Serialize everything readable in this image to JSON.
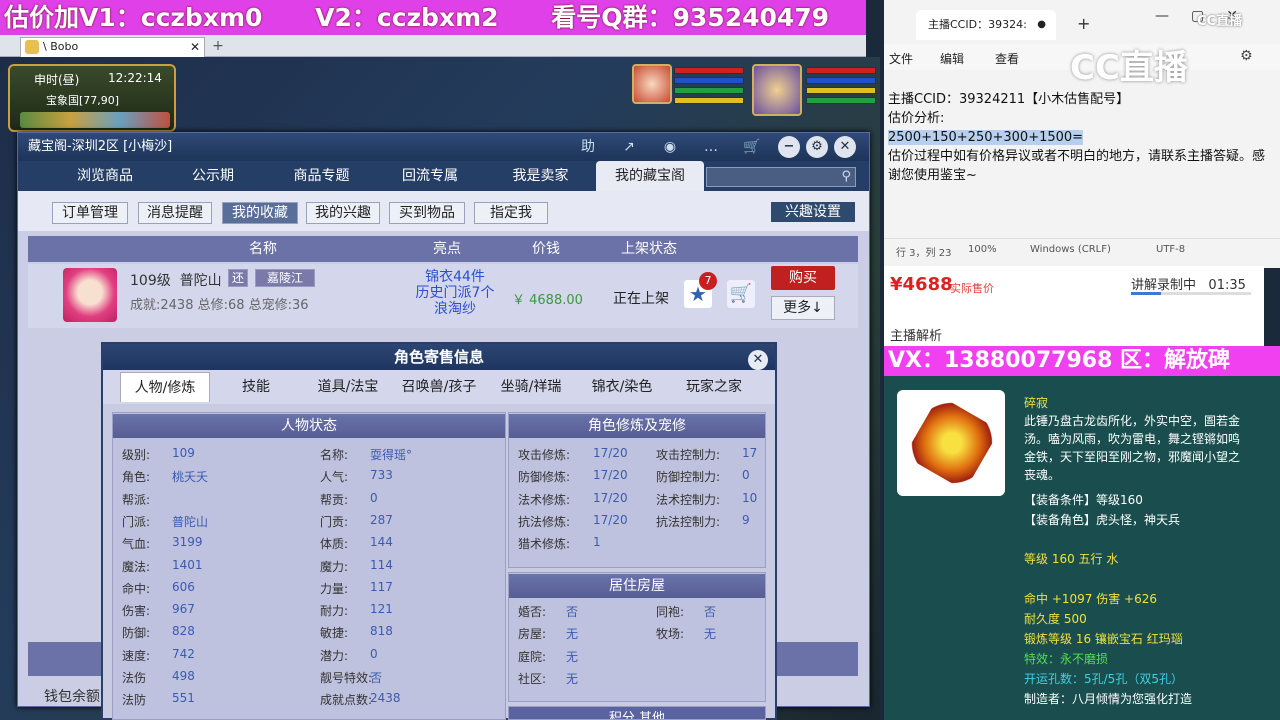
{
  "banner": {
    "items": [
      "估价加V1：cczbxm0",
      "V2：cczbxm2",
      "看号Q群：935240479"
    ]
  },
  "browser": {
    "tab_title": "\\ Bobo"
  },
  "hud": {
    "time_label": "申时(昼)",
    "time": "12:22:14",
    "location": "宝象国[77,90]"
  },
  "window": {
    "title": "藏宝阁-深圳2区 [小梅沙]",
    "title_buttons": [
      "助",
      "↗",
      "◉",
      "…",
      "🛒"
    ],
    "tabs": [
      "浏览商品",
      "公示期",
      "商品专题",
      "回流专属",
      "我是卖家",
      "我的藏宝阁"
    ],
    "sub_buttons": [
      "订单管理",
      "消息提醒",
      "我的收藏",
      "我的兴趣",
      "买到物品",
      "指定我"
    ],
    "interest_settings": "兴趣设置",
    "columns": [
      "名称",
      "亮点",
      "价钱",
      "上架状态"
    ],
    "wallet": "钱包余额"
  },
  "listing": {
    "level_label": "109级",
    "school": "普陀山",
    "badge_return": "还",
    "server": "嘉陵江",
    "stats": "成就:2438 总修:68 总宠修:36",
    "highlights": [
      "锦衣44件",
      "历史门派7个",
      "浪淘纱"
    ],
    "price": "￥ 4688.00",
    "status": "正在上架",
    "fav_count": "7",
    "buy": "购买",
    "more": "更多↓"
  },
  "popup": {
    "title": "角色寄售信息",
    "tabs": [
      "人物/修炼",
      "技能",
      "道具/法宝",
      "召唤兽/孩子",
      "坐骑/祥瑞",
      "锦衣/染色",
      "玩家之家"
    ],
    "status_head": "人物状态",
    "cultivation_head": "角色修炼及宠修",
    "home_head": "居住房屋",
    "bottom_head": "积分 其他",
    "left_col": [
      {
        "k": "级别:",
        "v": "109"
      },
      {
        "k": "角色:",
        "v": "桃夭夭"
      },
      {
        "k": "帮派:",
        "v": ""
      },
      {
        "k": "门派:",
        "v": "普陀山"
      },
      {
        "k": "气血:",
        "v": "3199"
      },
      {
        "k": "魔法:",
        "v": "1401"
      },
      {
        "k": "命中:",
        "v": "606"
      },
      {
        "k": "伤害:",
        "v": "967"
      },
      {
        "k": "防御:",
        "v": "828"
      },
      {
        "k": "速度:",
        "v": "742"
      },
      {
        "k": "法伤",
        "v": "498"
      },
      {
        "k": "法防",
        "v": "551"
      }
    ],
    "mid_col": [
      {
        "k": "名称:",
        "v": "耍得瑶°"
      },
      {
        "k": "人气:",
        "v": "733"
      },
      {
        "k": "帮贡:",
        "v": "0"
      },
      {
        "k": "门贡:",
        "v": "287"
      },
      {
        "k": "体质:",
        "v": "144"
      },
      {
        "k": "魔力:",
        "v": "114"
      },
      {
        "k": "力量:",
        "v": "117"
      },
      {
        "k": "耐力:",
        "v": "121"
      },
      {
        "k": "敏捷:",
        "v": "818"
      },
      {
        "k": "潜力:",
        "v": "0"
      },
      {
        "k": "靓号特效:",
        "v": "否"
      },
      {
        "k": "成就点数:",
        "v": "2438"
      }
    ],
    "cult_left": [
      {
        "k": "攻击修炼:",
        "v": "17/20"
      },
      {
        "k": "防御修炼:",
        "v": "17/20"
      },
      {
        "k": "法术修炼:",
        "v": "17/20"
      },
      {
        "k": "抗法修炼:",
        "v": "17/20"
      },
      {
        "k": "猎术修炼:",
        "v": "1"
      }
    ],
    "cult_right": [
      {
        "k": "攻击控制力:",
        "v": "17"
      },
      {
        "k": "防御控制力:",
        "v": "0"
      },
      {
        "k": "法术控制力:",
        "v": "10"
      },
      {
        "k": "抗法控制力:",
        "v": "9"
      }
    ],
    "home_left": [
      {
        "k": "婚否:",
        "v": "否"
      },
      {
        "k": "房屋:",
        "v": "无"
      },
      {
        "k": "庭院:",
        "v": "无"
      },
      {
        "k": "社区:",
        "v": "无"
      }
    ],
    "home_right": [
      {
        "k": "同袍:",
        "v": "否"
      },
      {
        "k": "牧场:",
        "v": "无"
      }
    ]
  },
  "notepad": {
    "tab": "主播CCID：39324:",
    "menu": [
      "文件",
      "编辑",
      "查看"
    ],
    "logo": "CC直播",
    "lines": [
      "主播CCID：39324211【小木估售配号】",
      "估价分析:"
    ],
    "selected_line": "2500+150+250+300+1500=",
    "tail": "估价过程中如有价格异议或者不明白的地方，请联系主播答疑。感谢您使用鉴宝~",
    "status": [
      "行 3，列 23",
      "100%",
      "Windows (CRLF)",
      "UTF-8"
    ]
  },
  "price_panel": {
    "price": "¥4688",
    "sub": "实际售价",
    "rec": "讲解录制中",
    "time": "01:35",
    "progress": 0.25,
    "analysis": "主播解析"
  },
  "vx_banner": "VX：13880077968 区：解放碑",
  "item": {
    "name": "碎寂",
    "desc": [
      "此锤乃盘古龙齿所化，外实中空，圄若金",
      "汤。嗑为风雨，吹为雷电，舞之铿锵如鸣",
      "金铁，天下至阳至刚之物，邪魔闻小望之",
      "丧魂。"
    ],
    "req_level": "【装备条件】等级160",
    "req_role": "【装备角色】虎头怪，神天兵",
    "level_line": "等级 160 五行 水",
    "stats_line": "命中 +1097 伤害 +626",
    "durability": "耐久度 500",
    "forge": "锻炼等级 16 镶嵌宝石 红玛瑙",
    "effect": "特效：永不磨损",
    "holes": "开运孔数：5孔/5孔（双5孔）",
    "maker": "制造者：八月倾情为您强化打造"
  }
}
